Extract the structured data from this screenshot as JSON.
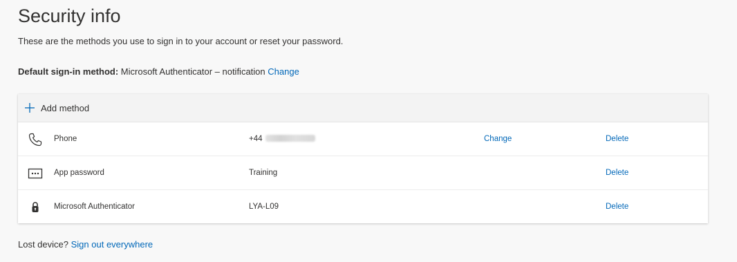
{
  "page": {
    "title": "Security info",
    "description": "These are the methods you use to sign in to your account or reset your password."
  },
  "default_method": {
    "label": "Default sign-in method:",
    "value": "Microsoft Authenticator – notification",
    "change_label": "Change"
  },
  "methods_card": {
    "add_method_label": "Add method",
    "add_icon": "plus-icon",
    "rows": [
      {
        "icon": "phone-icon",
        "name": "Phone",
        "detail": "+44",
        "detail_obscured": true,
        "change_label": "Change",
        "delete_label": "Delete"
      },
      {
        "icon": "app-password-icon",
        "name": "App password",
        "detail": "Training",
        "delete_label": "Delete"
      },
      {
        "icon": "lock-icon",
        "name": "Microsoft Authenticator",
        "detail": "LYA-L09",
        "delete_label": "Delete"
      }
    ]
  },
  "footer": {
    "lost_device_text": "Lost device?",
    "sign_out_label": "Sign out everywhere"
  },
  "colors": {
    "link": "#0067b8",
    "text": "#323130",
    "background": "#f8f8f8",
    "card_header": "#f3f3f3",
    "icon_blue": "#0067b8"
  }
}
